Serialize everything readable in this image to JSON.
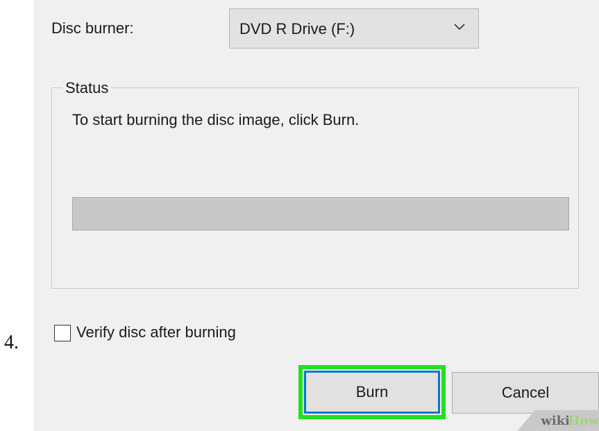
{
  "step_number": "4.",
  "dialog": {
    "disc_burner_label": "Disc burner:",
    "disc_burner_value": "DVD R Drive (F:)",
    "status_legend": "Status",
    "status_message": "To start burning the disc image, click Burn.",
    "progress_percent": 0,
    "verify_label": "Verify disc after burning",
    "verify_checked": false,
    "burn_label": "Burn",
    "cancel_label": "Cancel"
  },
  "watermark": {
    "wiki": "wiki",
    "how": "How"
  },
  "colors": {
    "dialog_bg": "#f0f0f0",
    "highlight": "#22e01f",
    "focus_border": "#0078d7",
    "progress_track": "#c8c8c8"
  },
  "icons": {
    "dropdown": "chevron-down-icon"
  }
}
